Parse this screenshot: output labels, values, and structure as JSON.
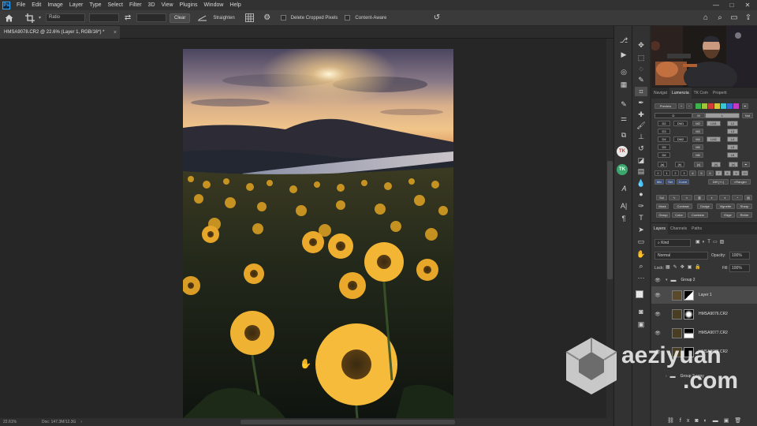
{
  "menubar": {
    "items": [
      "File",
      "Edit",
      "Image",
      "Layer",
      "Type",
      "Select",
      "Filter",
      "3D",
      "View",
      "Plugins",
      "Window",
      "Help"
    ]
  },
  "options": {
    "ratio": "Ratio",
    "clear": "Clear",
    "straighten": "Straighten",
    "delete_cropped": "Delete Cropped Pixels",
    "content_aware": "Content-Aware"
  },
  "document": {
    "tab_title": "HMSA9078.CR2 @ 22.6% (Layer 1, RGB/16*) *"
  },
  "status": {
    "zoom": "22.61%",
    "doc": "Doc: 147.3M/12.3G"
  },
  "lumenzia": {
    "tabs": [
      "Navigat",
      "Lumenzia",
      "TK Com",
      "Properti"
    ],
    "active_tab": "Lumenzia",
    "preview": "Preview",
    "col_d": "D",
    "col_m": "M",
    "col_l": "L",
    "not": "Not",
    "row1": [
      "D2",
      "DM1",
      "M2",
      "LM1",
      "L2"
    ],
    "row2": [
      "D3",
      "M3",
      "L3"
    ],
    "row3": [
      "D4",
      "DM2",
      "M4",
      "LM2",
      "L4"
    ],
    "row4": [
      "D5",
      "M5",
      "L5"
    ],
    "row5": [
      "D6",
      "M6",
      "L6"
    ],
    "zone_row": [
      "{a}",
      "{b}",
      "{c}",
      "{d}",
      "{e}"
    ],
    "num_row": [
      "0",
      "1",
      "2",
      "3",
      "4",
      "5",
      "6",
      "7",
      "8",
      "9",
      "10"
    ],
    "mode_row": [
      "Mix",
      "Sel",
      "Curve"
    ],
    "diff": "Diff (+/-)",
    "range": "<Range>",
    "sol": "Sol",
    "bottom1": [
      "Mask",
      "Contrast",
      "Dodge",
      "Vignette",
      "Sharp"
    ],
    "bottom2": [
      "Group",
      "Color",
      "Combine",
      "Edge",
      "Retire"
    ]
  },
  "layers": {
    "tabs": [
      "Layers",
      "Channels",
      "Paths"
    ],
    "kind": "Kind",
    "blend": "Normal",
    "opacity_label": "Opacity:",
    "opacity": "100%",
    "lock_label": "Lock:",
    "fill_label": "Fill:",
    "fill": "100%",
    "group2": "Group 2",
    "items": [
      "Layer 1",
      "HMSA9076.CR2",
      "HMSA9077.CR2",
      "HMSA9078.CR2"
    ],
    "group2copy": "Group 2 copy"
  },
  "watermark": {
    "line1": "aeziyuan",
    "line2": ".com"
  },
  "colors": {
    "accent": "#31a8ff",
    "bg": "#262626",
    "panel": "#353535"
  }
}
